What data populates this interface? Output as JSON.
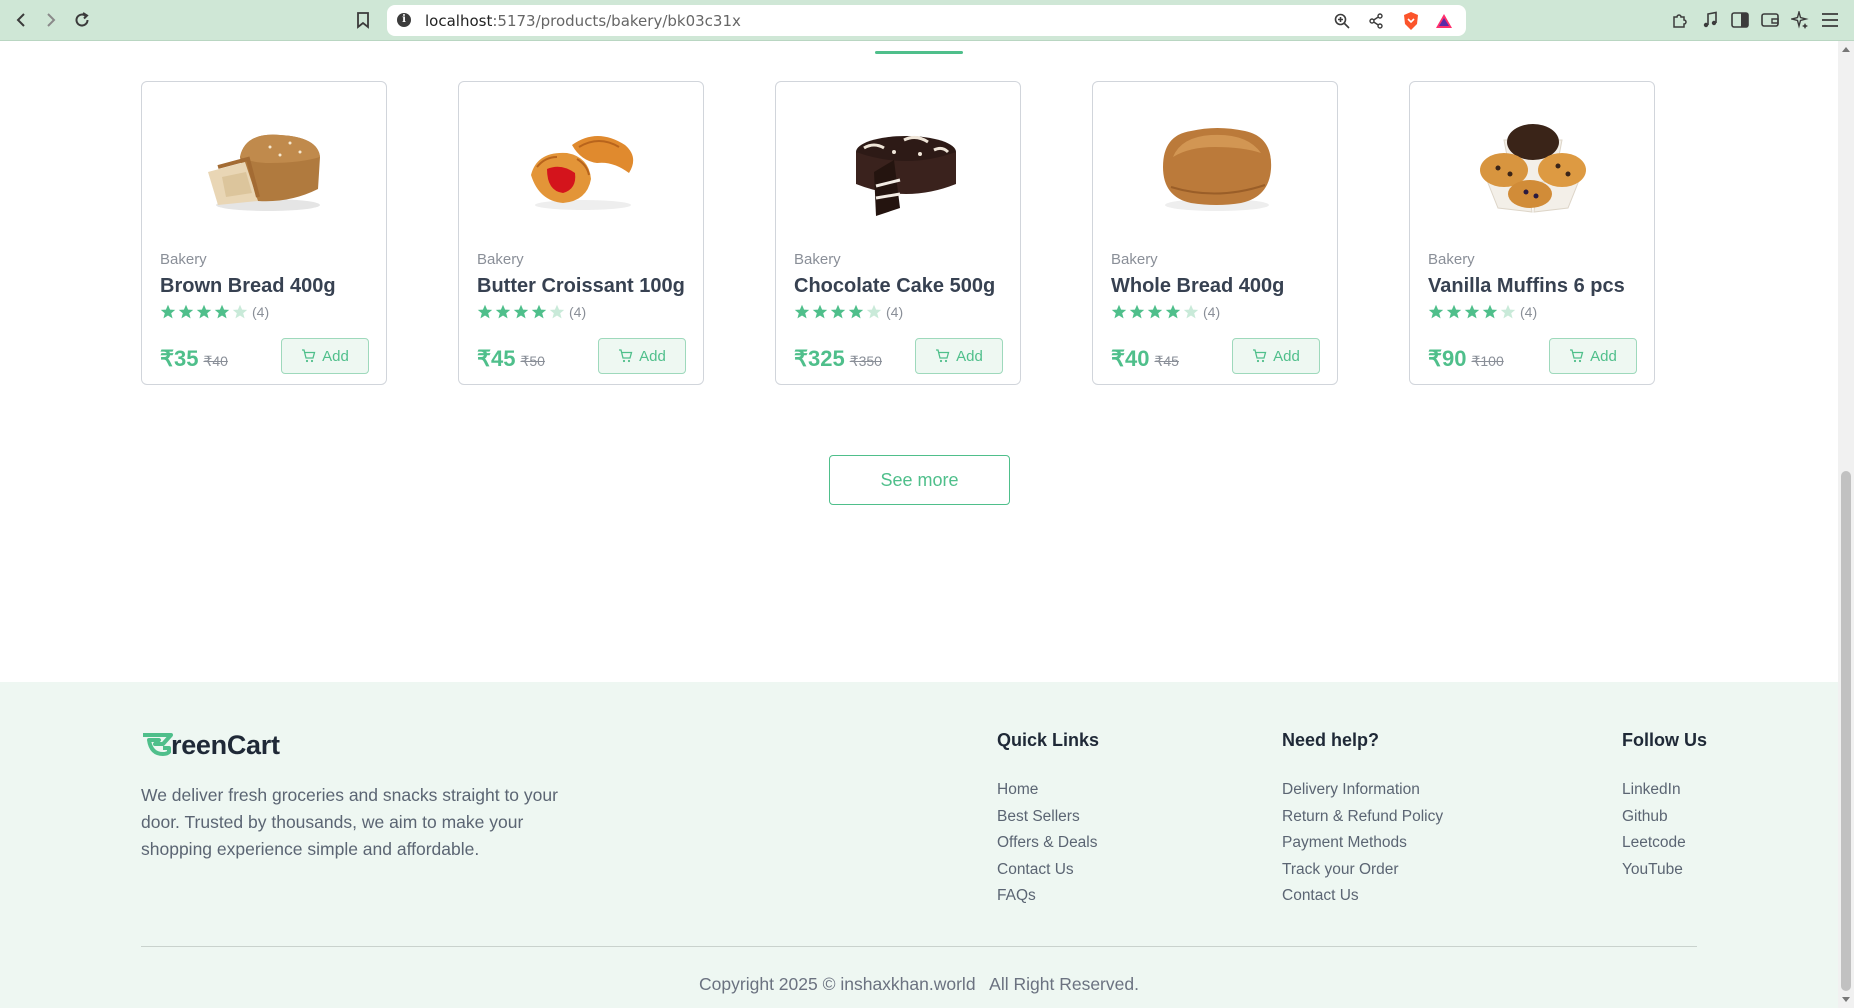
{
  "browser": {
    "url_host": "localhost",
    "url_path": ":5173/products/bakery/bk03c31x"
  },
  "products": [
    {
      "category": "Bakery",
      "name": "Brown Bread 400g",
      "rating": 4,
      "rating_count": "(4)",
      "price": "₹35",
      "old_price": "₹40",
      "add_label": "Add",
      "image_icon": "brown-bread-image"
    },
    {
      "category": "Bakery",
      "name": "Butter Croissant 100g",
      "rating": 4,
      "rating_count": "(4)",
      "price": "₹45",
      "old_price": "₹50",
      "add_label": "Add",
      "image_icon": "croissant-image"
    },
    {
      "category": "Bakery",
      "name": "Chocolate Cake 500g",
      "rating": 4,
      "rating_count": "(4)",
      "price": "₹325",
      "old_price": "₹350",
      "add_label": "Add",
      "image_icon": "chocolate-cake-image"
    },
    {
      "category": "Bakery",
      "name": "Whole Bread 400g",
      "rating": 4,
      "rating_count": "(4)",
      "price": "₹40",
      "old_price": "₹45",
      "add_label": "Add",
      "image_icon": "whole-bread-image"
    },
    {
      "category": "Bakery",
      "name": "Vanilla Muffins 6 pcs",
      "rating": 4,
      "rating_count": "(4)",
      "price": "₹90",
      "old_price": "₹100",
      "add_label": "Add",
      "image_icon": "muffins-image"
    }
  ],
  "see_more": "See more",
  "footer": {
    "brand": "reenCart",
    "about": "We deliver fresh groceries and snacks straight to your door. Trusted by thousands, we aim to make your shopping experience simple and affordable.",
    "columns": [
      {
        "title": "Quick Links",
        "links": [
          "Home",
          "Best Sellers",
          "Offers & Deals",
          "Contact Us",
          "FAQs"
        ]
      },
      {
        "title": "Need help?",
        "links": [
          "Delivery Information",
          "Return & Refund Policy",
          "Payment Methods",
          "Track your Order",
          "Contact Us"
        ]
      },
      {
        "title": "Follow Us",
        "links": [
          "LinkedIn",
          "Github",
          "Leetcode",
          "YouTube"
        ]
      }
    ],
    "copyright": "Copyright 2025 © inshaxkhan.world   All Right Reserved."
  },
  "colors": {
    "accent": "#4fbf8b",
    "footer_bg": "#eef7f2",
    "chrome_bg": "#cfe7d6"
  }
}
